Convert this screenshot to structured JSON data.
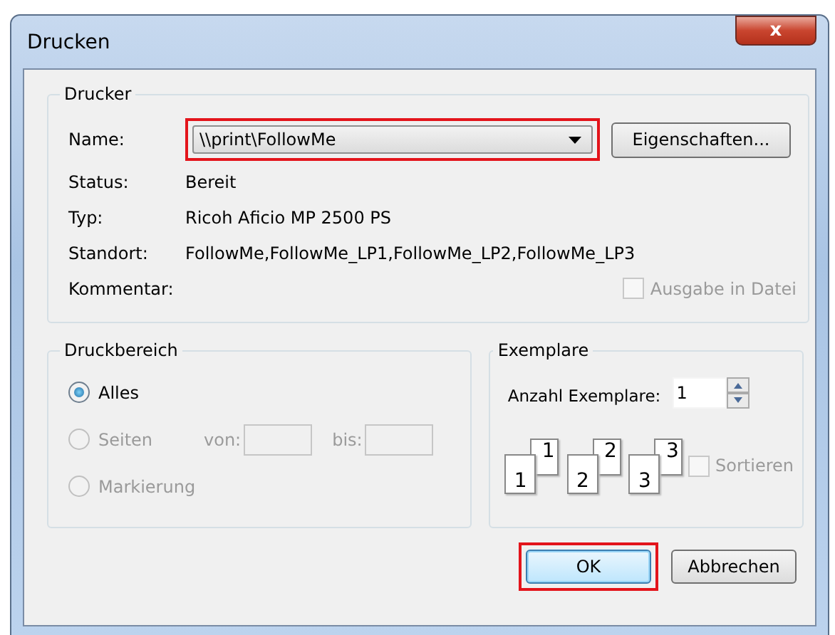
{
  "window": {
    "title": "Drucken",
    "close": "x"
  },
  "printer": {
    "legend": "Drucker",
    "name_label": "Name:",
    "name_value": "\\\\print\\FollowMe",
    "name_highlighted": true,
    "properties_button": "Eigenschaften...",
    "info": [
      {
        "label": "Status:",
        "value": "Bereit"
      },
      {
        "label": "Typ:",
        "value": "Ricoh Aficio MP 2500 PS"
      },
      {
        "label": "Standort:",
        "value": "FollowMe,FollowMe_LP1,FollowMe_LP2,FollowMe_LP3"
      },
      {
        "label": "Kommentar:"
      }
    ],
    "print_to_file": {
      "label": "Ausgabe in Datei",
      "checked": false,
      "disabled": true
    }
  },
  "range": {
    "legend": "Druckbereich",
    "options": [
      {
        "label": "Alles",
        "selected": true,
        "disabled": false
      },
      {
        "label": "Seiten",
        "selected": false,
        "disabled": true,
        "from_label": "von:",
        "to_label": "bis:"
      },
      {
        "label": "Markierung",
        "selected": false,
        "disabled": true
      }
    ]
  },
  "copies": {
    "legend": "Exemplare",
    "count_label": "Anzahl Exemplare:",
    "count_value": "1",
    "pages": [
      {
        "back": "1",
        "front": "1"
      },
      {
        "back": "2",
        "front": "2"
      },
      {
        "back": "3",
        "front": "3"
      }
    ],
    "collate": {
      "label": "Sortieren",
      "checked": false,
      "disabled": true
    }
  },
  "buttons": [
    {
      "label": "OK",
      "highlighted": true
    },
    {
      "label": "Abbrechen",
      "highlighted": false
    }
  ]
}
